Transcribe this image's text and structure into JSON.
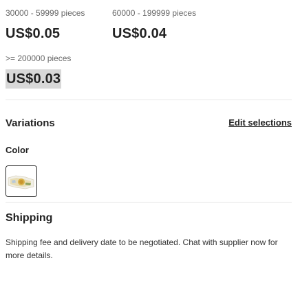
{
  "pricing": {
    "tiers": [
      {
        "range": "30000 - 59999 pieces",
        "price": "US$0.05"
      },
      {
        "range": "60000 - 199999 pieces",
        "price": "US$0.04"
      },
      {
        "range": ">= 200000 pieces",
        "price": "US$0.03"
      }
    ]
  },
  "variations": {
    "title": "Variations",
    "edit_label": "Edit selections",
    "color_label": "Color",
    "swatch_icon": "product-thumbnail-image"
  },
  "shipping": {
    "title": "Shipping",
    "note": "Shipping fee and delivery date to be negotiated. Chat with supplier now for more details."
  },
  "colors": {
    "text": "#222222",
    "muted": "#666666",
    "divider": "#e6e6e6",
    "highlight": "#d8d8d8"
  }
}
